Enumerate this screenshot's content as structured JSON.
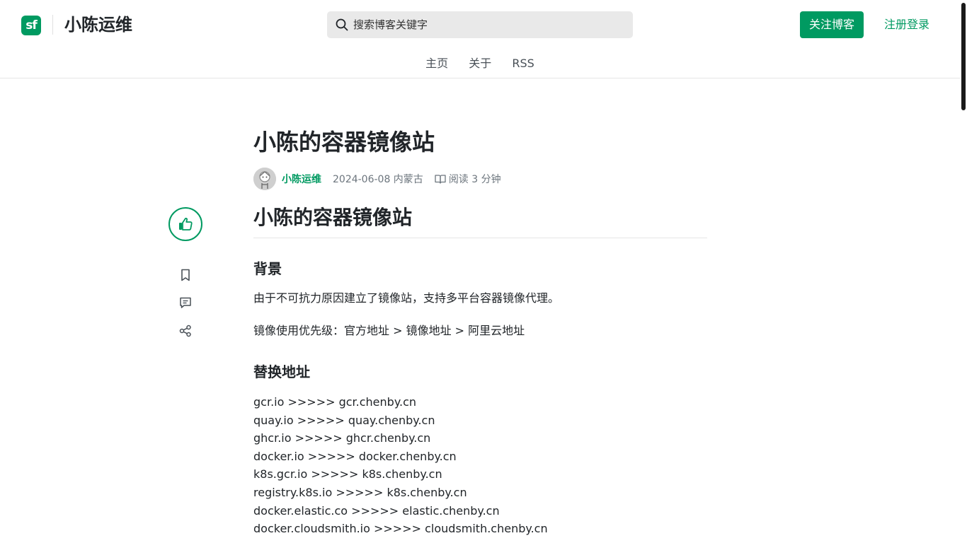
{
  "header": {
    "logo_text": "sf",
    "blog_name": "小陈运维",
    "search_placeholder": "搜索博客关键字",
    "follow_label": "关注博客",
    "login_label": "注册登录",
    "accent_color": "#009a61"
  },
  "nav": {
    "items": [
      "主页",
      "关于",
      "RSS"
    ]
  },
  "article": {
    "title": "小陈的容器镜像站",
    "author": "小陈运维",
    "date_location": "2024-06-08 内蒙古",
    "read_time": "阅读 3 分钟",
    "heading1": "小陈的容器镜像站",
    "section_background": "背景",
    "para1": "由于不可抗力原因建立了镜像站，支持多平台容器镜像代理。",
    "para2": "镜像使用优先级：官方地址 > 镜像地址 > 阿里云地址",
    "section_replace": "替换地址",
    "mappings": [
      "gcr.io >>>>> gcr.chenby.cn",
      "quay.io >>>>> quay.chenby.cn",
      "ghcr.io >>>>> ghcr.chenby.cn",
      "docker.io >>>>> docker.chenby.cn",
      "k8s.gcr.io >>>>> k8s.chenby.cn",
      "registry.k8s.io >>>>> k8s.chenby.cn",
      "docker.elastic.co >>>>> elastic.chenby.cn",
      "docker.cloudsmith.io >>>>> cloudsmith.chenby.cn"
    ]
  },
  "sidebar": {
    "icons": [
      "thumbs-up-icon",
      "bookmark-icon",
      "comment-icon",
      "share-icon"
    ]
  }
}
